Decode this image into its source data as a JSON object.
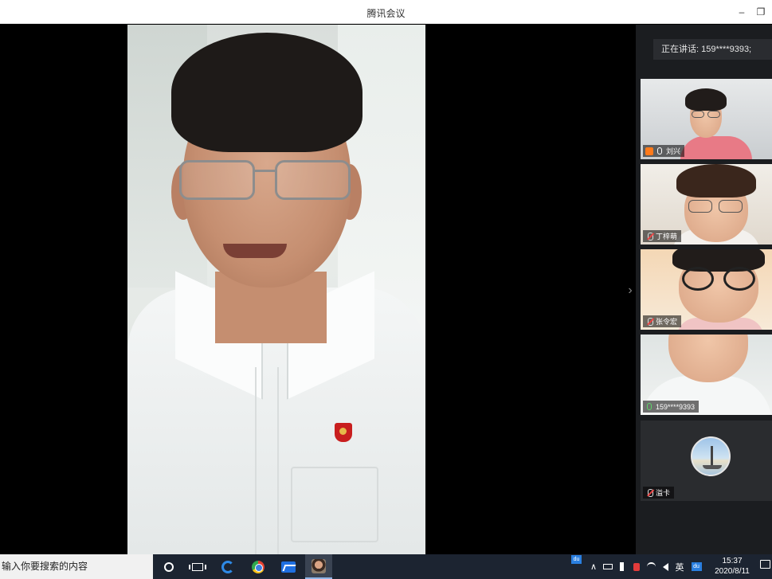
{
  "window": {
    "title": "腾讯会议",
    "minimize_glyph": "–",
    "restore_glyph": "❐"
  },
  "meeting": {
    "speaking_text": "正在讲话: 159****9393;",
    "panel_toggle_glyph": "›",
    "participants": [
      {
        "name": "刘兴",
        "icon": "camera-and-mic-icon"
      },
      {
        "name": "丁梓萌",
        "icon": "mic-muted-icon"
      },
      {
        "name": "张令宏",
        "icon": "mic-muted-icon"
      },
      {
        "name": "159****9393",
        "icon": "mic-active-icon"
      },
      {
        "name": "溢卡",
        "icon": "mic-muted-icon"
      }
    ]
  },
  "taskbar": {
    "search_placeholder": "输入你要搜索的内容",
    "apps": [
      "cortana-icon",
      "task-view-icon",
      "edge-icon",
      "chrome-icon",
      "tencent-meeting-icon",
      "photo-app-icon"
    ],
    "tray": {
      "du_label": "du",
      "ime": "英",
      "du2": "du",
      "chevron": "∧"
    },
    "time": "15:37",
    "date": "2020/8/11"
  },
  "colors": {
    "panel_bg": "#1b1d20",
    "taskbar_bg": "#1c2431",
    "titlebar_bg": "#ffffff"
  }
}
